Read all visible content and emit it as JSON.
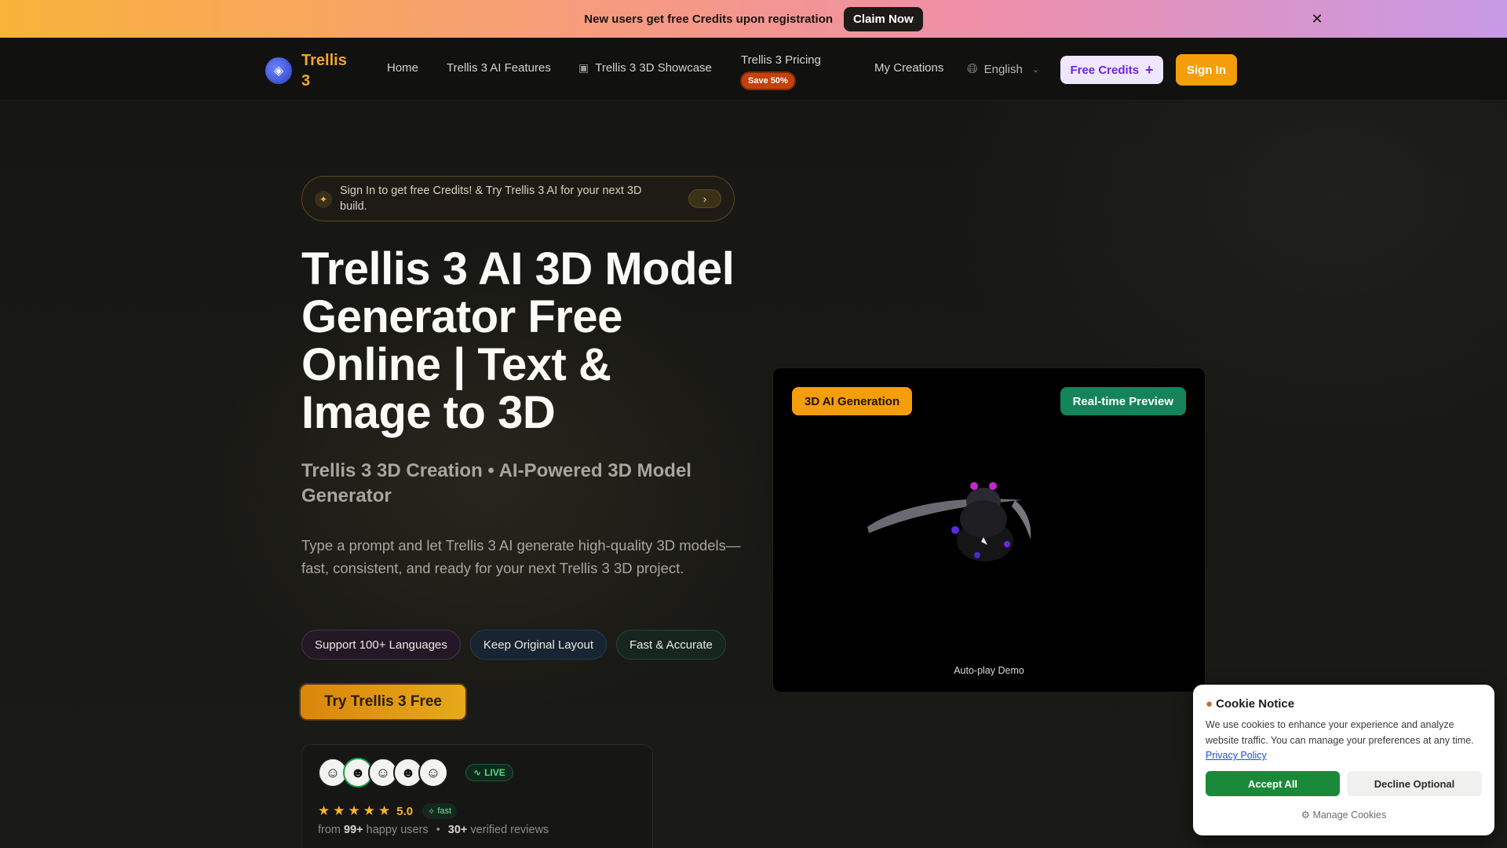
{
  "banner": {
    "text": "New users get free Credits upon registration",
    "button": "Claim Now",
    "close_icon": "close-icon"
  },
  "nav": {
    "logo_text": "Trellis 3",
    "links": {
      "home": "Home",
      "features": "Trellis 3 AI Features",
      "showcase": "Trellis 3 3D Showcase",
      "pricing": "Trellis 3 Pricing",
      "pricing_badge": "Save 50%",
      "creations": "My Creations"
    },
    "language": "English",
    "free_credits": "Free Credits",
    "sign_in": "Sign In"
  },
  "hero": {
    "promo": "Sign In to get free Credits! & Try Trellis 3 AI for your next 3D build.",
    "title": "Trellis 3 AI 3D Model Generator Free Online | Text & Image to 3D",
    "subtitle": "Trellis 3 3D Creation • AI-Powered 3D Model Generator",
    "description": "Type a prompt and let Trellis 3 AI generate high-quality 3D models—fast, consistent, and ready for your next Trellis 3 3D project.",
    "tags": [
      "Support 100+ Languages",
      "Keep Original Layout",
      "Fast & Accurate"
    ],
    "cta": "Try Trellis 3 Free"
  },
  "social_proof": {
    "live": "LIVE",
    "rating": "5.0",
    "fast": "fast",
    "from": "from",
    "users_count": "99+",
    "users_suffix": "happy users",
    "reviews_count": "30+",
    "reviews_suffix": "verified reviews",
    "stars": 5
  },
  "demo": {
    "badge_left": "3D AI Generation",
    "badge_right": "Real-time Preview",
    "caption": "Auto-play Demo"
  },
  "cookie": {
    "title": "Cookie Notice",
    "text": "We use cookies to enhance your experience and analyze website traffic. You can manage your preferences at any time.",
    "link": "Privacy Policy",
    "accept": "Accept All",
    "decline": "Decline Optional",
    "manage": "Manage Cookies"
  },
  "colors": {
    "accent": "#f59e0b",
    "brand_text": "#f5a623",
    "preview_badge": "#15845a",
    "accept": "#1a8a3a"
  }
}
